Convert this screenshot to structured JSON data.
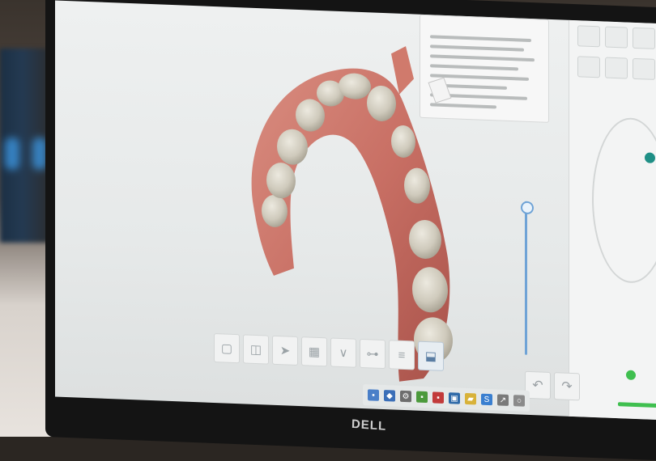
{
  "monitor": {
    "brand": "DELL"
  },
  "toolbar": {
    "buttons": [
      {
        "name": "view-button-1",
        "icon": "cube-icon"
      },
      {
        "name": "view-button-2",
        "icon": "cube-outline-icon"
      },
      {
        "name": "arrow-button",
        "icon": "arrow-icon"
      },
      {
        "name": "grid-button",
        "icon": "grid-icon"
      },
      {
        "name": "trim-button",
        "icon": "v-trim-icon"
      },
      {
        "name": "brightness-button",
        "icon": "slider-icon"
      },
      {
        "name": "layers-button",
        "icon": "layers-icon"
      },
      {
        "name": "scan-button",
        "icon": "scanner-icon"
      }
    ]
  },
  "taskbar": {
    "icons": [
      "window-icon",
      "share-icon",
      "settings-icon",
      "green-app-icon",
      "red-app-icon",
      "building-icon",
      "folder-icon",
      "s-app-icon",
      "arrow-app-icon",
      "circle-icon"
    ]
  },
  "colors": {
    "accent_blue": "#6fa3d6",
    "teal": "#1f8f86",
    "green": "#3fbf4f",
    "gum": "#c9746a",
    "tooth": "#d8d4c8"
  }
}
